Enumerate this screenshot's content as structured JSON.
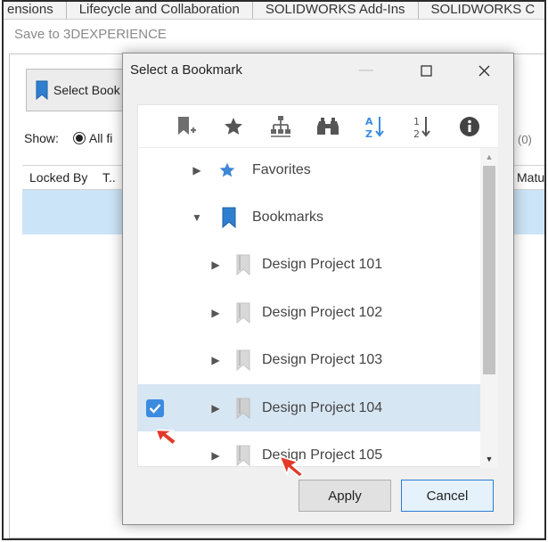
{
  "tabs": [
    "ensions",
    "Lifecycle and Collaboration",
    "SOLIDWORKS Add-Ins",
    "SOLIDWORKS C"
  ],
  "background": {
    "title": "Save to 3DEXPERIENCE",
    "select_button_label": "Select Book",
    "show_label": "Show:",
    "radio_label": "All fi",
    "count": "(0)",
    "columns": [
      "Locked By",
      "T..",
      "Maturi"
    ]
  },
  "dialog": {
    "title": "Select a Bookmark",
    "toolbar_icons": [
      "add-bookmark-icon",
      "star-icon",
      "hierarchy-icon",
      "binoculars-icon",
      "sort-az-icon",
      "sort-numeric-icon",
      "info-icon"
    ],
    "tree": [
      {
        "label": "Favorites",
        "icon": "star-icon",
        "expanded": false,
        "level": 0
      },
      {
        "label": "Bookmarks",
        "icon": "bookmark-icon",
        "expanded": true,
        "level": 0
      },
      {
        "label": "Design Project 101",
        "icon": "bookmark-icon",
        "expanded": false,
        "level": 1
      },
      {
        "label": "Design Project 102",
        "icon": "bookmark-icon",
        "expanded": false,
        "level": 1
      },
      {
        "label": "Design Project 103",
        "icon": "bookmark-icon",
        "expanded": false,
        "level": 1
      },
      {
        "label": "Design Project 104",
        "icon": "bookmark-icon",
        "expanded": false,
        "level": 1,
        "checked": true,
        "selected": true
      },
      {
        "label": "Design Project 105",
        "icon": "bookmark-icon",
        "expanded": false,
        "level": 1
      }
    ],
    "apply_label": "Apply",
    "cancel_label": "Cancel"
  },
  "colors": {
    "accent_blue": "#3b8be0",
    "selection": "#d7e6f3",
    "pointer_red": "#e23a2a"
  }
}
